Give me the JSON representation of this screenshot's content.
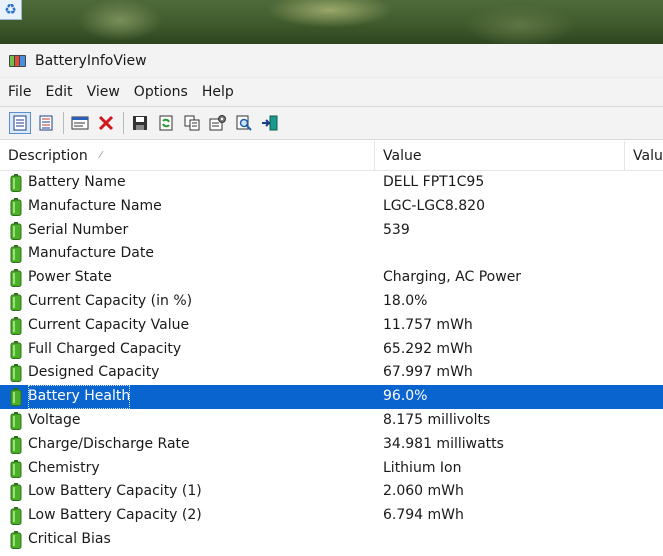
{
  "window": {
    "title": "BatteryInfoView"
  },
  "menu": [
    "File",
    "Edit",
    "View",
    "Options",
    "Help"
  ],
  "toolbar": {
    "buttons": [
      "view-mode-battery-info-icon",
      "view-mode-battery-log-icon",
      "properties-window-icon",
      "delete-icon",
      "save-icon",
      "refresh-icon",
      "copy-icon",
      "options-icon",
      "find-icon",
      "exit-icon"
    ]
  },
  "columns": {
    "description": "Description",
    "value": "Value",
    "value2": "Value"
  },
  "rows": [
    {
      "description": "Battery Name",
      "value": "DELL FPT1C95"
    },
    {
      "description": "Manufacture Name",
      "value": "LGC-LGC8.820"
    },
    {
      "description": "Serial Number",
      "value": "539"
    },
    {
      "description": "Manufacture Date",
      "value": ""
    },
    {
      "description": "Power State",
      "value": "Charging, AC Power"
    },
    {
      "description": "Current Capacity (in %)",
      "value": "18.0%"
    },
    {
      "description": "Current Capacity Value",
      "value": "11.757 mWh"
    },
    {
      "description": "Full Charged Capacity",
      "value": "65.292 mWh"
    },
    {
      "description": "Designed Capacity",
      "value": "67.997 mWh"
    },
    {
      "description": "Battery Health",
      "value": "96.0%",
      "selected": true
    },
    {
      "description": "Voltage",
      "value": "8.175 millivolts"
    },
    {
      "description": "Charge/Discharge Rate",
      "value": "34.981 milliwatts"
    },
    {
      "description": "Chemistry",
      "value": "Lithium Ion"
    },
    {
      "description": "Low Battery Capacity (1)",
      "value": "2.060 mWh"
    },
    {
      "description": "Low Battery Capacity (2)",
      "value": "6.794 mWh"
    },
    {
      "description": "Critical Bias",
      "value": ""
    }
  ],
  "colors": {
    "selection": "#0a64cf",
    "battery_green": "#4caf2a"
  }
}
